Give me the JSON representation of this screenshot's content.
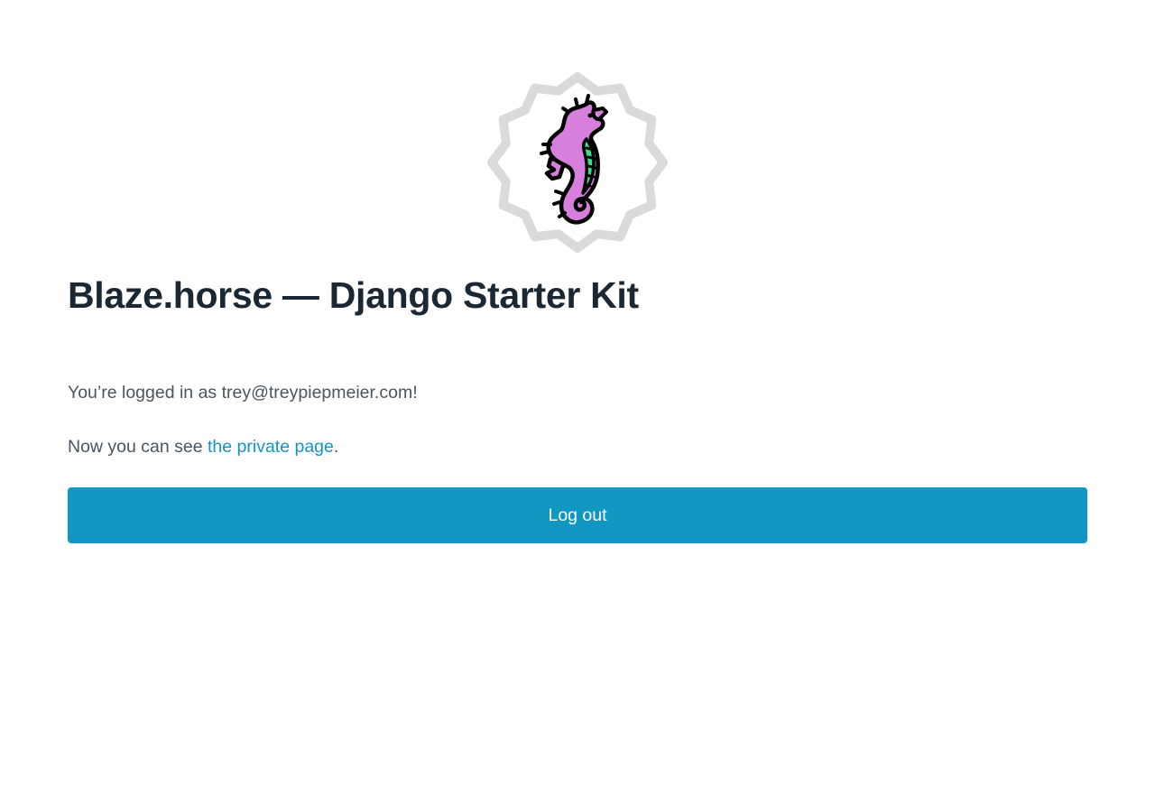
{
  "logo": {
    "icon": "seahorse-badge-icon",
    "colors": {
      "badge": "#dadada",
      "seahorse_body": "#d67fdc",
      "seahorse_belly": "#38e08a",
      "outline": "#000000"
    }
  },
  "header": {
    "title": "Blaze.horse — Django Starter Kit"
  },
  "main": {
    "status_text": "You’re logged in as trey@treypiepmeier.com!",
    "private_prefix": "Now you can see ",
    "private_link": "the private page",
    "private_suffix": ".",
    "logout_label": "Log out"
  },
  "colors": {
    "accent": "#1297c2",
    "link": "#1395c3",
    "heading": "#1b2733",
    "body_text": "#4a5560"
  }
}
